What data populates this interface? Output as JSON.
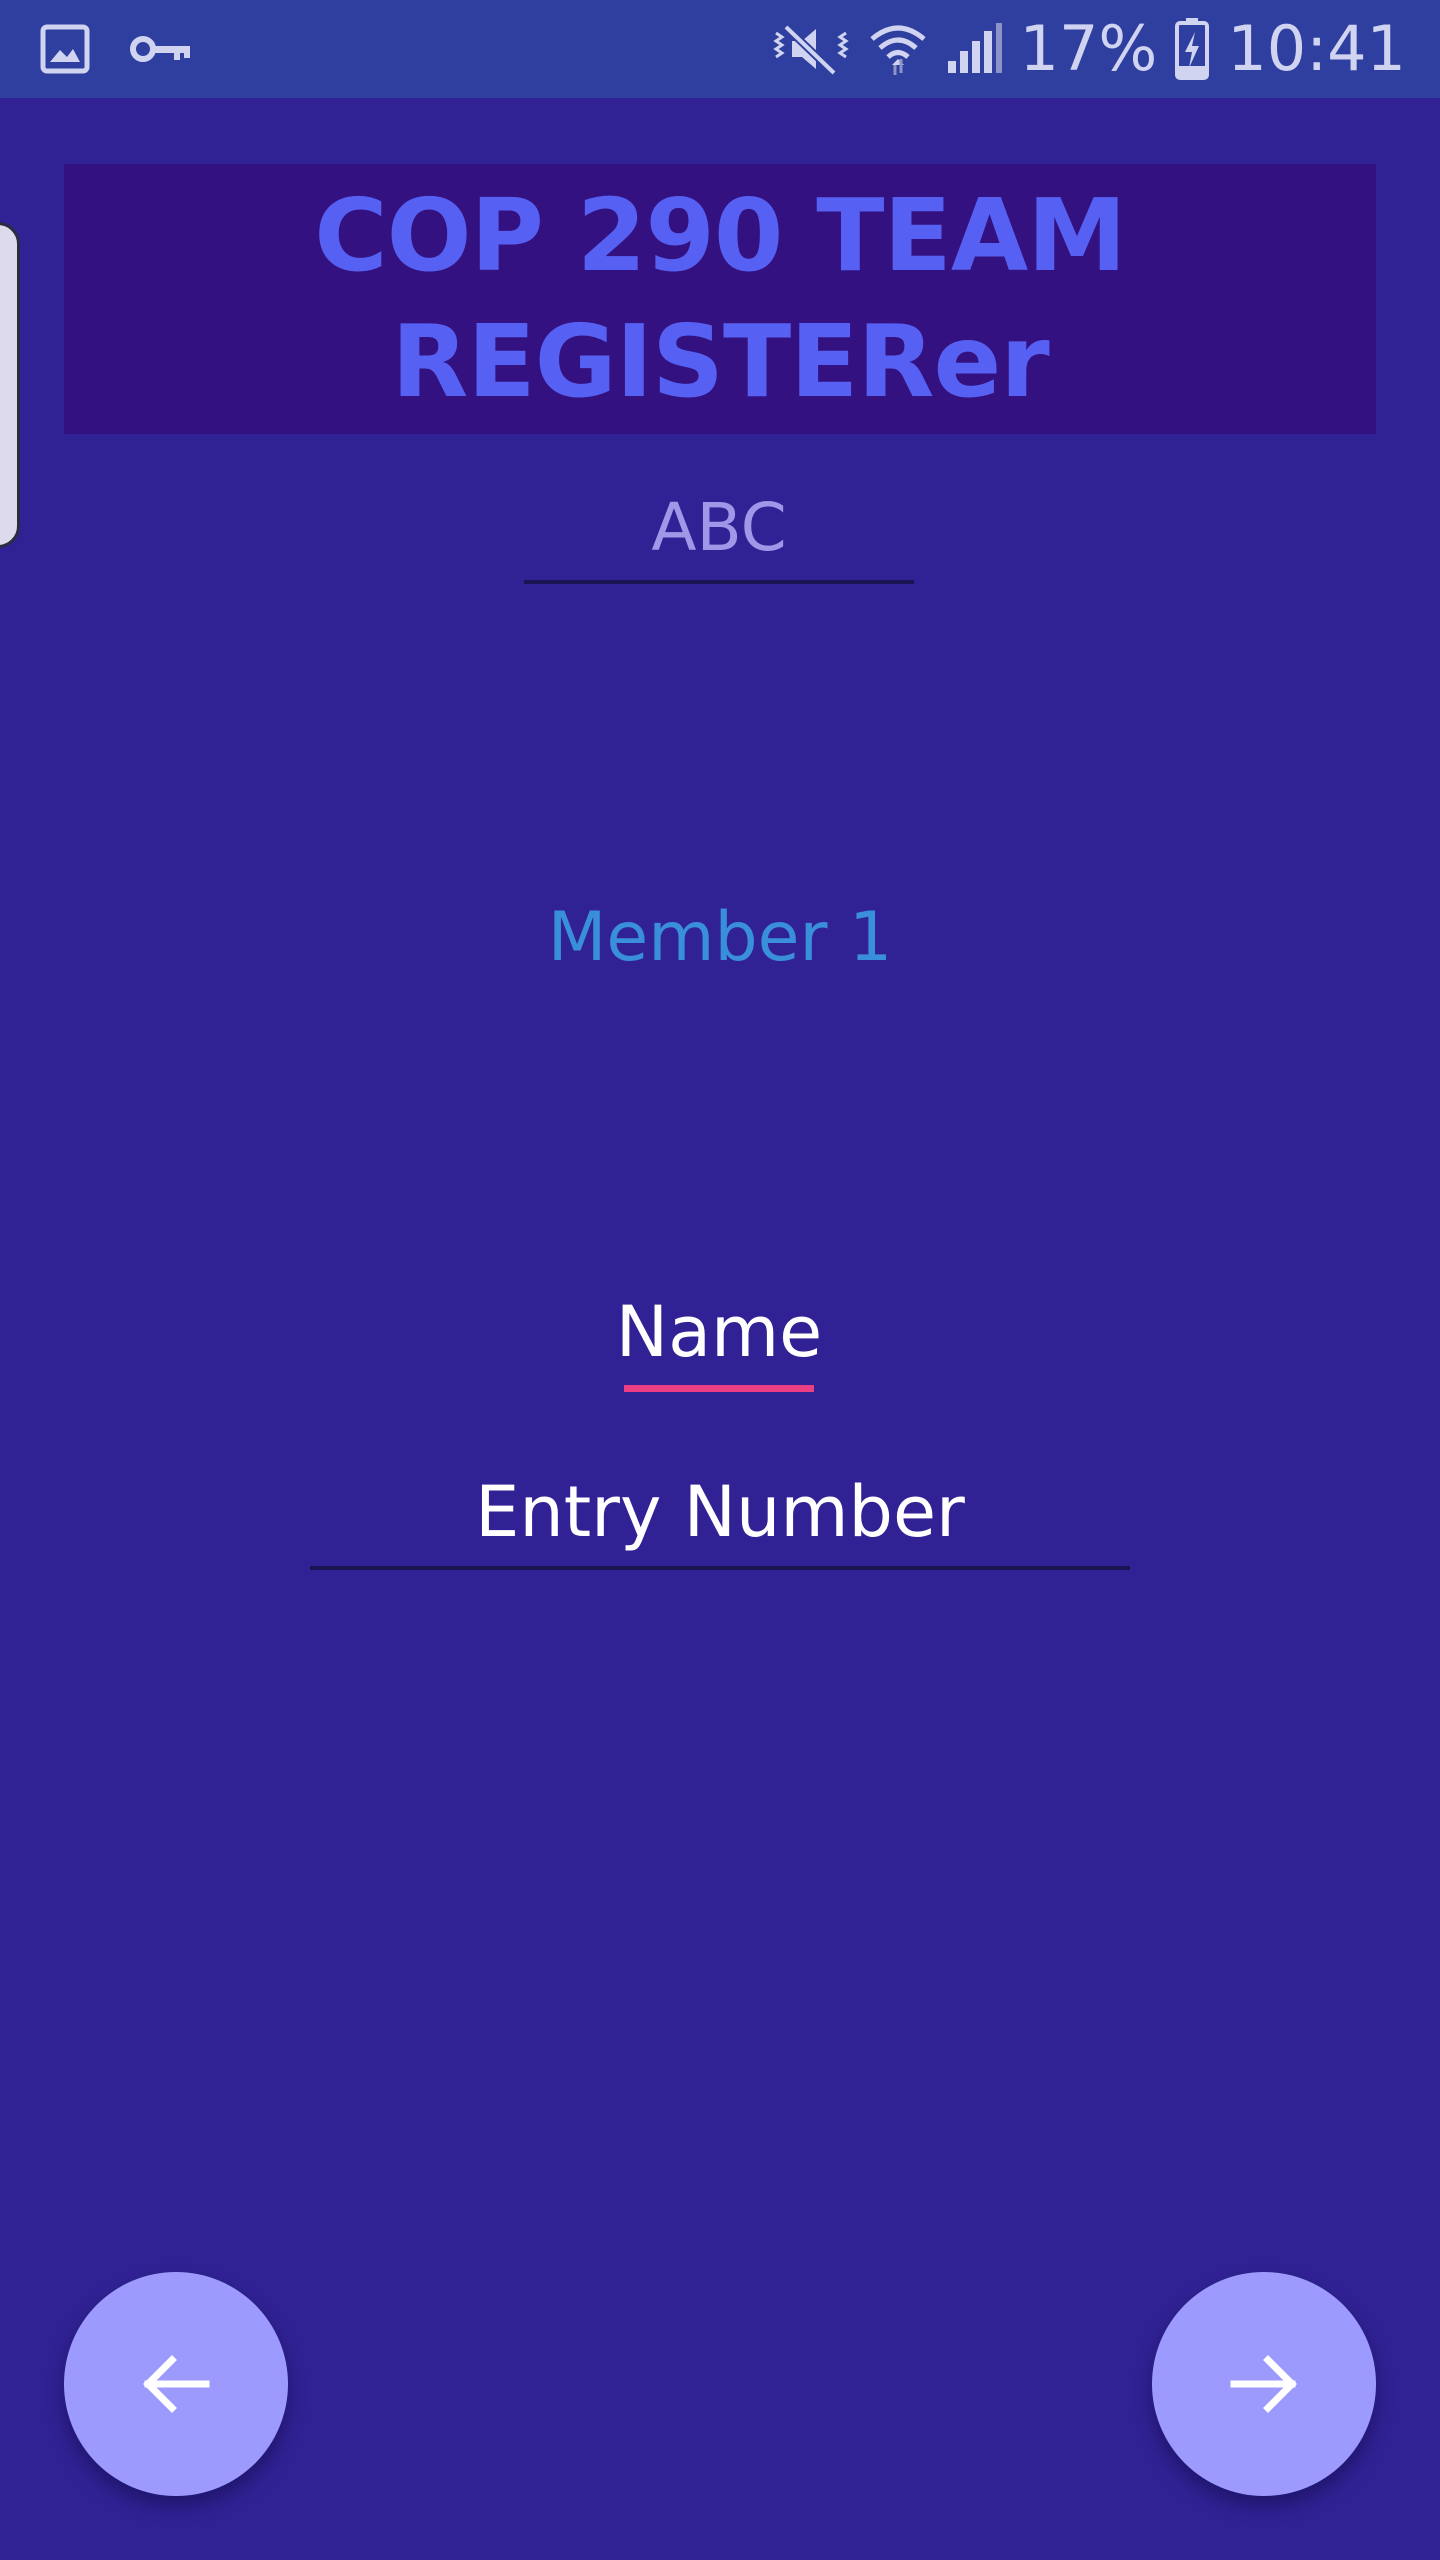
{
  "status_bar": {
    "battery_percent": "17%",
    "time": "10:41",
    "icons": {
      "left": [
        "gallery-icon",
        "key-icon"
      ],
      "right": [
        "mute-vibrate-icon",
        "wifi-icon",
        "cellular-signal-icon",
        "battery-charging-icon"
      ]
    }
  },
  "header": {
    "title": "COP 290 TEAM REGISTERer"
  },
  "form": {
    "team_name_value": "ABC",
    "member_heading": "Member 1",
    "name_placeholder": "Name",
    "entry_number_placeholder": "Entry Number"
  },
  "navigation": {
    "back_icon": "arrow-left-icon",
    "next_icon": "arrow-right-icon"
  },
  "colors": {
    "background": "#302294",
    "status_bar": "#2f3fa0",
    "title_banner": "#331180",
    "title_text": "#5661f3",
    "member_heading": "#3a8fdb",
    "focus_underline": "#ec3f83",
    "fab": "#9c9afd"
  }
}
